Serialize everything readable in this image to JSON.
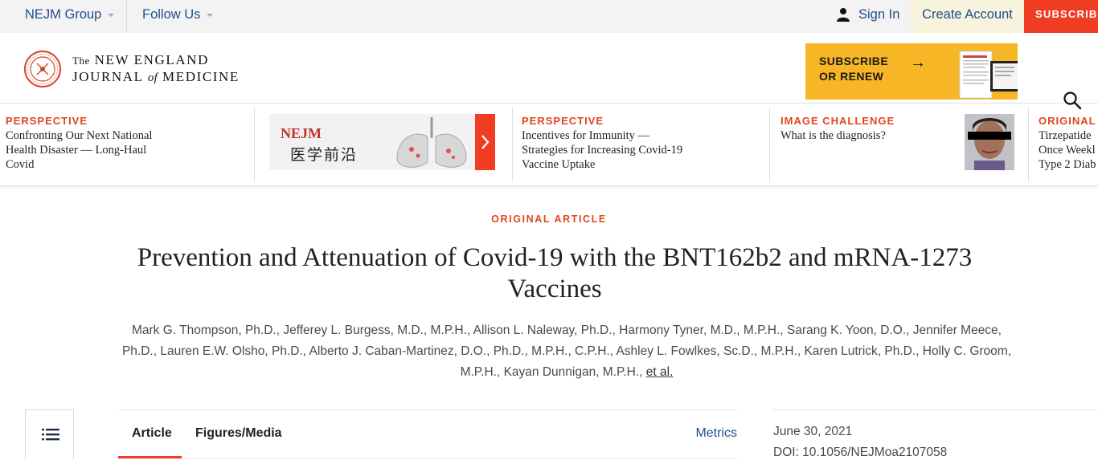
{
  "topbar": {
    "nejm_group": "NEJM Group",
    "follow_us": "Follow Us",
    "sign_in": "Sign In",
    "create_account": "Create Account",
    "subscribe": "SUBSCRIBE"
  },
  "brand": {
    "the": "The",
    "line1": "NEW ENGLAND",
    "line2a": "JOURNAL",
    "line2_of": "of",
    "line2b": "MEDICINE",
    "seal_icon": "nejm-seal-icon"
  },
  "promo": {
    "line1": "SUBSCRIBE",
    "line2": "OR RENEW",
    "arrow": "→",
    "bg_color": "#f7b626"
  },
  "carousel": [
    {
      "kicker": "PERSPECTIVE",
      "title": "Confronting Our Next National Health Disaster — Long-Haul Covid"
    },
    {
      "ad_logo": "NEJM",
      "ad_cn": "医学前沿"
    },
    {
      "kicker": "PERSPECTIVE",
      "title": "Incentives for Immunity — Strategies for Increasing Covid-19 Vaccine Uptake"
    },
    {
      "kicker": "IMAGE CHALLENGE",
      "title": "What is the diagnosis?"
    },
    {
      "kicker": "ORIGINAL",
      "title": "Tirzepatide Once Weekl Type 2 Diab"
    }
  ],
  "article": {
    "kicker": "ORIGINAL ARTICLE",
    "title": "Prevention and Attenuation of Covid-19 with the BNT162b2 and mRNA-1273 Vaccines",
    "authors": "Mark G. Thompson, Ph.D., Jefferey L. Burgess, M.D., M.P.H., Allison L. Naleway, Ph.D., Harmony Tyner, M.D., M.P.H., Sarang K. Yoon, D.O., Jennifer Meece, Ph.D., Lauren E.W. Olsho, Ph.D., Alberto J. Caban-Martinez, D.O., Ph.D., M.P.H., C.P.H., Ashley L. Fowlkes, Sc.D., M.P.H., Karen Lutrick, Ph.D., Holly C. Groom, M.P.H., Kayan Dunnigan, M.P.H.,",
    "et_al": "et al."
  },
  "tabs": {
    "article": "Article",
    "figures": "Figures/Media",
    "metrics": "Metrics"
  },
  "meta": {
    "date": "June 30, 2021",
    "doi": "DOI: 10.1056/NEJMoa2107058"
  },
  "colors": {
    "accent": "#ef3c23",
    "link": "#1e4e8c",
    "kicker": "#e0461e"
  }
}
